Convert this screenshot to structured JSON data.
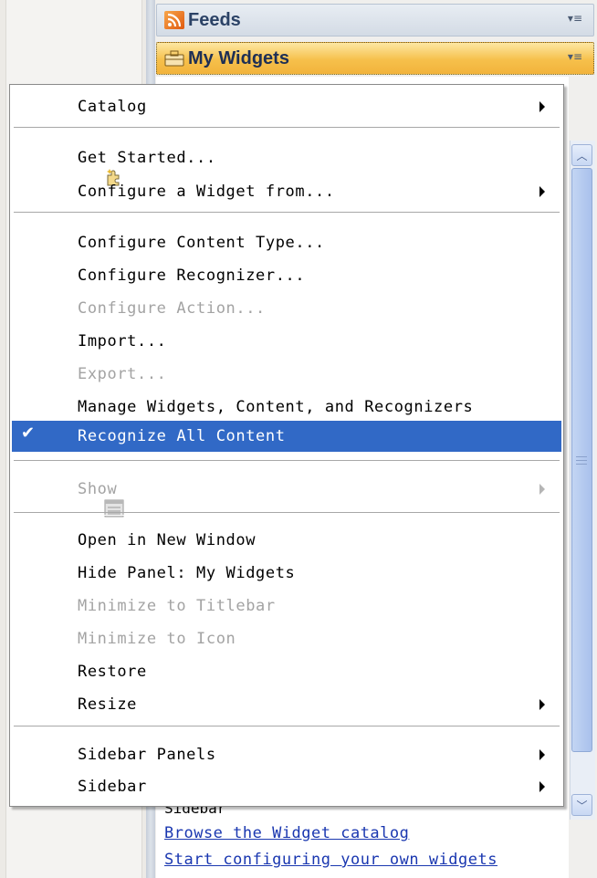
{
  "panels": {
    "feeds_title": "Feeds",
    "widgets_title": "My Widgets"
  },
  "background": {
    "sidebar_heading": "Sidebar",
    "browse_link": "Browse the Widget catalog",
    "configure_link": "Start configuring your own widgets"
  },
  "menu": {
    "catalog": "Catalog",
    "get_started": "Get Started...",
    "configure_widget_from": "Configure a Widget from...",
    "configure_content_type": "Configure Content Type...",
    "configure_recognizer": "Configure Recognizer...",
    "configure_action": "Configure Action...",
    "import": "Import...",
    "export": "Export...",
    "manage": "Manage Widgets, Content, and Recognizers",
    "recognize_all": "Recognize All Content",
    "show": "Show",
    "open_new_window": "Open in New Window",
    "hide_panel": "Hide Panel: My Widgets",
    "minimize_titlebar": "Minimize to Titlebar",
    "minimize_icon": "Minimize to Icon",
    "restore": "Restore",
    "resize": "Resize",
    "sidebar_panels": "Sidebar Panels",
    "sidebar": "Sidebar"
  },
  "icons": {
    "rss": "rss-feed-icon",
    "briefcase": "briefcase-icon",
    "puzzle": "puzzle-sparkle-icon",
    "show": "window-list-icon",
    "check": "checkmark-icon",
    "submenu": "submenu-arrow-icon"
  },
  "colors": {
    "selection": "#3169c6",
    "widgets_header": "#f6c04b",
    "disabled_text": "#a3a3a3",
    "link": "#1a37b0"
  }
}
